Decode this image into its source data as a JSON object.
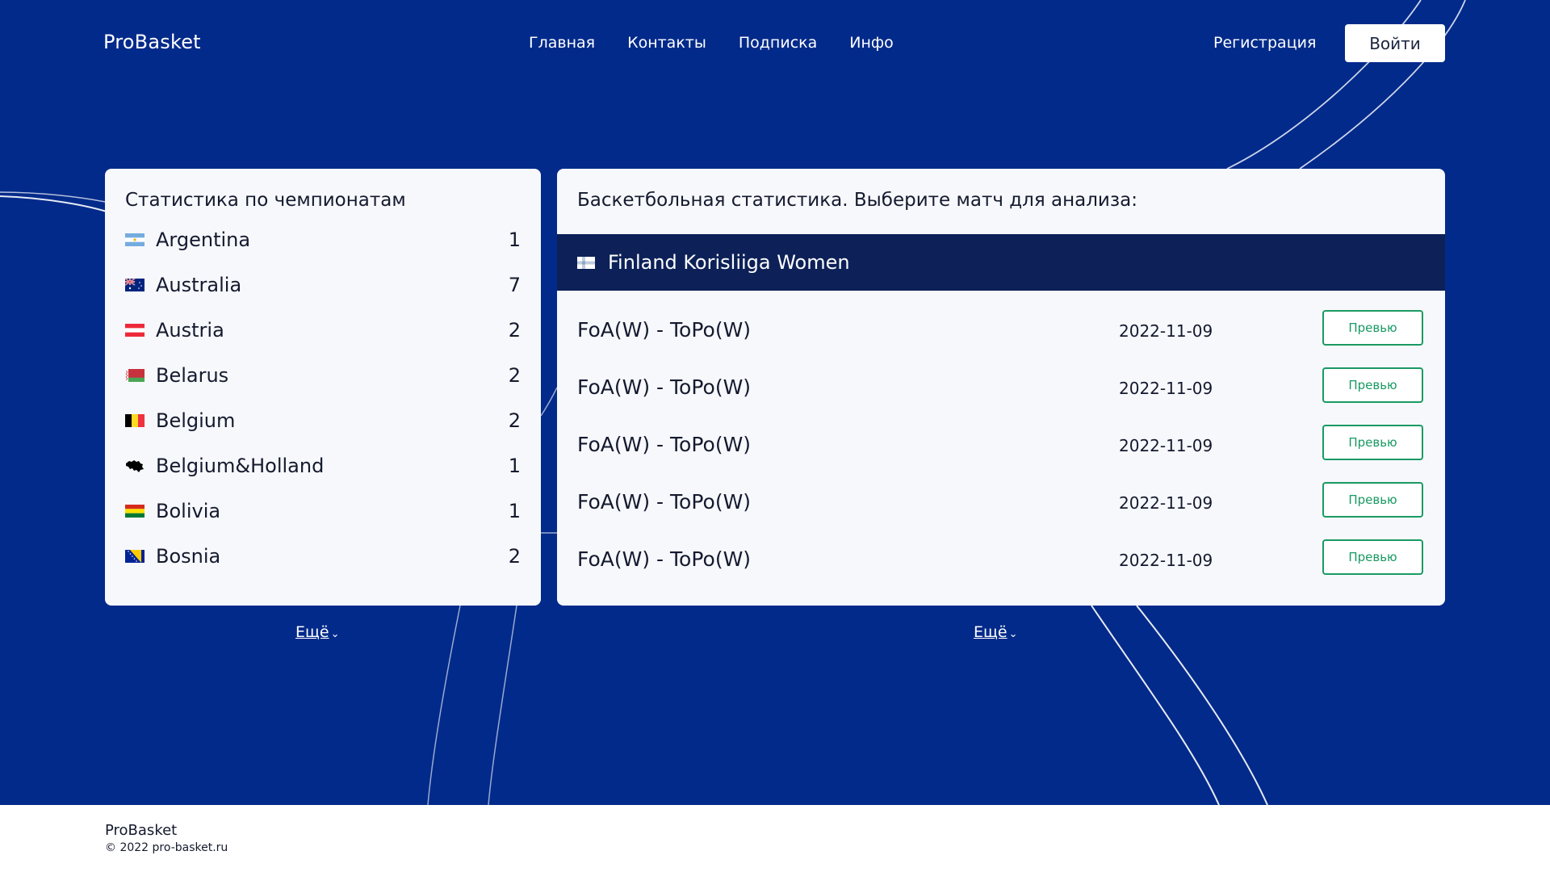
{
  "brand": "ProBasket",
  "nav": {
    "items": [
      "Главная",
      "Контакты",
      "Подписка",
      "Инфо"
    ],
    "register_label": "Регистрация",
    "login_label": "Войти"
  },
  "championships": {
    "title": "Статистика по чемпионатам",
    "items": [
      {
        "name": "Argentina",
        "count": "1"
      },
      {
        "name": "Australia",
        "count": "7"
      },
      {
        "name": "Austria",
        "count": "2"
      },
      {
        "name": "Belarus",
        "count": "2"
      },
      {
        "name": "Belgium",
        "count": "2"
      },
      {
        "name": "Belgium&Holland",
        "count": "1"
      },
      {
        "name": "Bolivia",
        "count": "1"
      },
      {
        "name": "Bosnia",
        "count": "2"
      }
    ],
    "more_label": "Ещё"
  },
  "matches": {
    "title": "Баскетбольная статистика. Выберите матч для анализа:",
    "league": "Finland Korisliiga Women",
    "items": [
      {
        "teams": "FoA(W) - ToPo(W)",
        "date": "2022-11-09",
        "button": "Превью"
      },
      {
        "teams": "FoA(W) - ToPo(W)",
        "date": "2022-11-09",
        "button": "Превью"
      },
      {
        "teams": "FoA(W) - ToPo(W)",
        "date": "2022-11-09",
        "button": "Превью"
      },
      {
        "teams": "FoA(W) - ToPo(W)",
        "date": "2022-11-09",
        "button": "Превью"
      },
      {
        "teams": "FoA(W) - ToPo(W)",
        "date": "2022-11-09",
        "button": "Превью"
      }
    ],
    "more_label": "Ещё"
  },
  "footer": {
    "brand": "ProBasket",
    "copyright": "© 2022 pro-basket.ru"
  },
  "colors": {
    "hero_background": "#022a8a",
    "league_bar": "#0d2158",
    "preview_green": "#1a9a63"
  }
}
